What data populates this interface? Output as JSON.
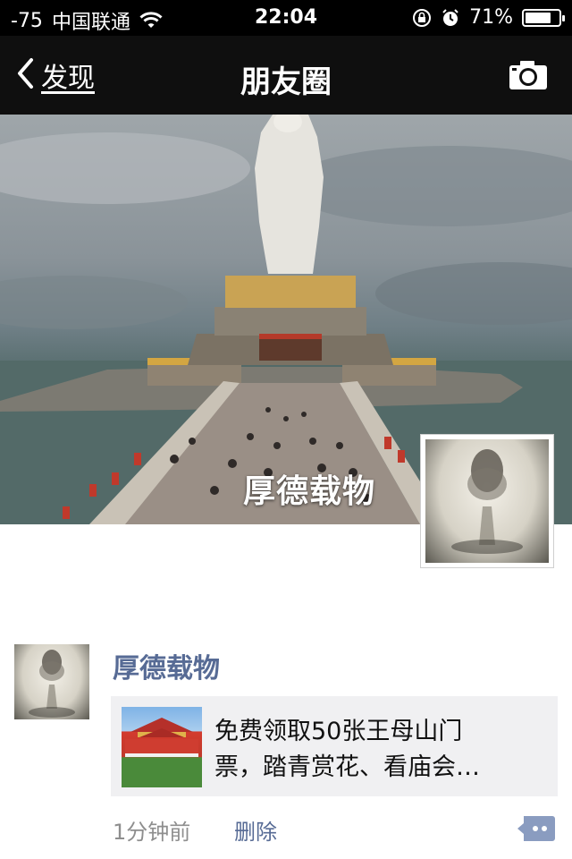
{
  "status_bar": {
    "signal": "-75",
    "carrier": "中国联通",
    "time": "22:04",
    "battery": "71%",
    "battery_level": 0.71,
    "icons": [
      "wifi-icon",
      "rotation-lock-icon",
      "alarm-icon",
      "battery-icon"
    ]
  },
  "nav": {
    "back_label": "发现",
    "title": "朋友圈",
    "camera_icon": "camera-icon"
  },
  "cover": {
    "name": "厚德载物"
  },
  "post": {
    "author": "厚德载物",
    "share_text_line1": "免费领取50张王母山门",
    "share_text_line2": "票，踏青赏花、看庙会…",
    "time": "1分钟前",
    "delete_label": "删除",
    "comment_icon": "comment-icon"
  },
  "colors": {
    "link_blue": "#576b95",
    "nav_bg": "#0f0f0f"
  }
}
